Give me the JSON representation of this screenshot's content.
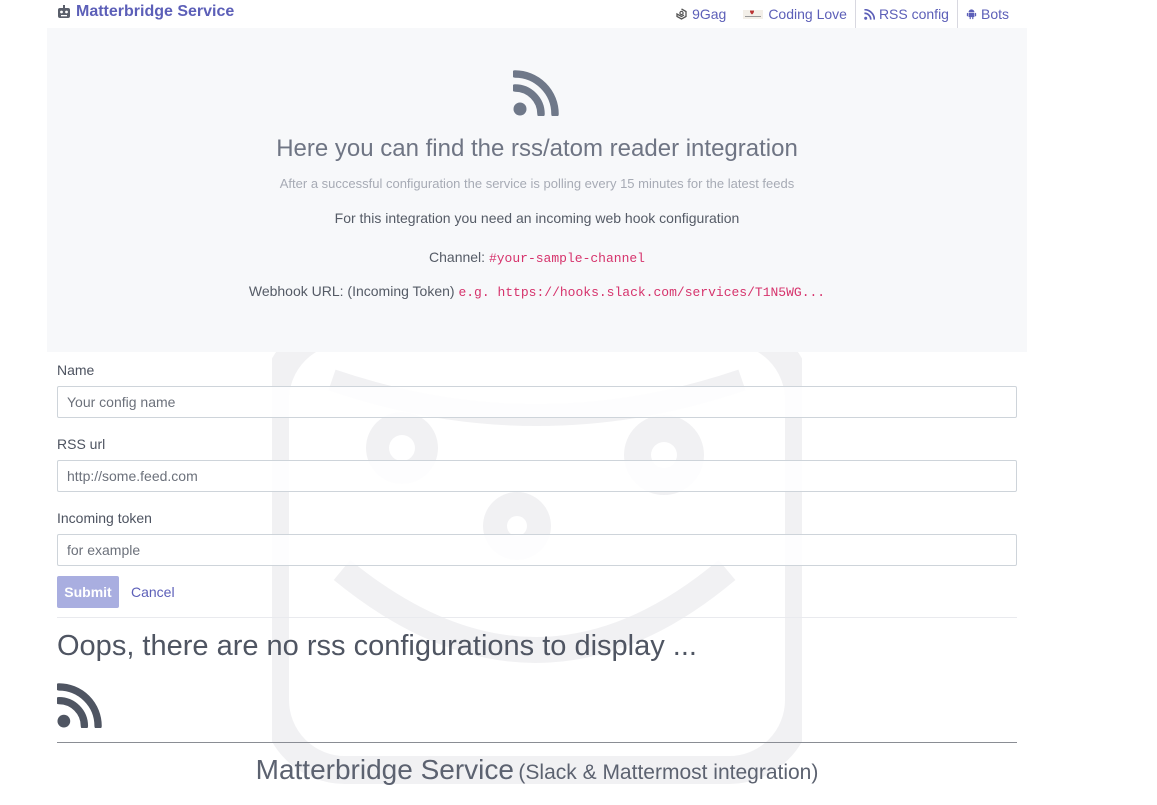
{
  "navbar": {
    "brand": "Matterbridge Service",
    "links": [
      {
        "label": "9Gag",
        "icon": "9gag-icon"
      },
      {
        "label": "Coding Love",
        "icon": "coding-love-icon"
      },
      {
        "label": "RSS config",
        "icon": "rss-icon",
        "active": true
      },
      {
        "label": "Bots",
        "icon": "android-icon"
      }
    ]
  },
  "jumbotron": {
    "icon": "rss-icon",
    "title": "Here you can find the rss/atom reader integration",
    "lead": "After a successful configuration the service is polling every 15 minutes for the latest feeds",
    "need": "For this integration you need an incoming web hook configuration",
    "channel_label": "Channel:",
    "channel_value": "#your-sample-channel",
    "webhook_label": "Webhook URL: (Incoming Token)",
    "webhook_value": "e.g. https://hooks.slack.com/services/T1N5WG..."
  },
  "form": {
    "name_label": "Name",
    "name_placeholder": "Your config name",
    "rss_label": "RSS url",
    "rss_placeholder": "http://some.feed.com",
    "token_label": "Incoming token",
    "token_placeholder": "for example",
    "submit_label": "Submit",
    "cancel_label": "Cancel"
  },
  "empty_state": {
    "message": "Oops, there are no rss configurations to display ...",
    "icon": "rss-icon"
  },
  "footer": {
    "title": "Matterbridge Service",
    "subtitle": "(Slack & Mattermost integration)"
  },
  "colors": {
    "accent": "#5c5fb8",
    "jumbotron_bg": "#f7f8fa",
    "code": "#d6336c",
    "submit_bg": "#a9aee0"
  }
}
